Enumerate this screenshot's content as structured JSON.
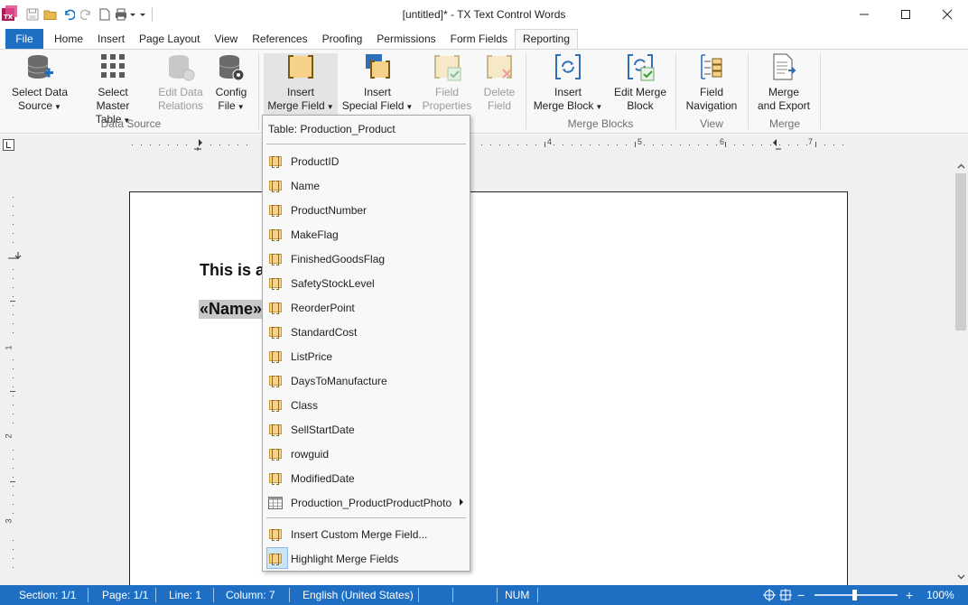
{
  "window": {
    "title": "[untitled]* - TX Text Control Words"
  },
  "tabs": [
    {
      "label": "File"
    },
    {
      "label": "Home"
    },
    {
      "label": "Insert"
    },
    {
      "label": "Page Layout"
    },
    {
      "label": "View"
    },
    {
      "label": "References"
    },
    {
      "label": "Proofing"
    },
    {
      "label": "Permissions"
    },
    {
      "label": "Form Fields"
    },
    {
      "label": "Reporting"
    }
  ],
  "ribbon": {
    "data_source": {
      "group_label": "Data Source",
      "select_data_source": {
        "line1": "Select Data",
        "line2": "Source"
      },
      "select_master_table": {
        "line1": "Select",
        "line2": "Master Table"
      },
      "edit_data_relations": {
        "line1": "Edit Data",
        "line2": "Relations"
      },
      "config_file": {
        "line1": "Config",
        "line2": "File"
      }
    },
    "merge_fields": {
      "insert_merge_field": {
        "line1": "Insert",
        "line2": "Merge Field"
      },
      "insert_special_field": {
        "line1": "Insert",
        "line2": "Special Field"
      },
      "field_properties": {
        "line1": "Field",
        "line2": "Properties"
      },
      "delete_field": {
        "line1": "Delete",
        "line2": "Field"
      }
    },
    "merge_blocks": {
      "group_label": "Merge Blocks",
      "insert_merge_block": {
        "line1": "Insert",
        "line2": "Merge Block"
      },
      "edit_merge_block": {
        "line1": "Edit Merge",
        "line2": "Block"
      }
    },
    "view": {
      "group_label": "View",
      "field_navigation": {
        "line1": "Field",
        "line2": "Navigation"
      }
    },
    "merge": {
      "group_label": "Merge",
      "merge_and_export": {
        "line1": "Merge",
        "line2": "and Export"
      }
    }
  },
  "document": {
    "line1": "This is a",
    "line2": "«Name»"
  },
  "menu": {
    "header": "Table: Production_Product",
    "fields": [
      "ProductID",
      "Name",
      "ProductNumber",
      "MakeFlag",
      "FinishedGoodsFlag",
      "SafetyStockLevel",
      "ReorderPoint",
      "StandardCost",
      "ListPrice",
      "DaysToManufacture",
      "Class",
      "SellStartDate",
      "rowguid",
      "ModifiedDate"
    ],
    "sub_table": "Production_ProductProductPhoto",
    "insert_custom": "Insert Custom Merge Field...",
    "highlight": "Highlight Merge Fields"
  },
  "ruler": {
    "h_numbers": [
      "4",
      "5",
      "6",
      "7"
    ],
    "v_numbers": [
      "1",
      "2",
      "3"
    ]
  },
  "status": {
    "section": "Section: 1/1",
    "page": "Page: 1/1",
    "line": "Line: 1",
    "column": "Column: 7",
    "language": "English (United States)",
    "num": "NUM",
    "zoom": "100%",
    "zoom_minus": "−",
    "zoom_plus": "+"
  },
  "colors": {
    "accent": "#1e6fc4",
    "merge_field_fill": "#f5d18a",
    "highlight": "#cce4f7"
  }
}
